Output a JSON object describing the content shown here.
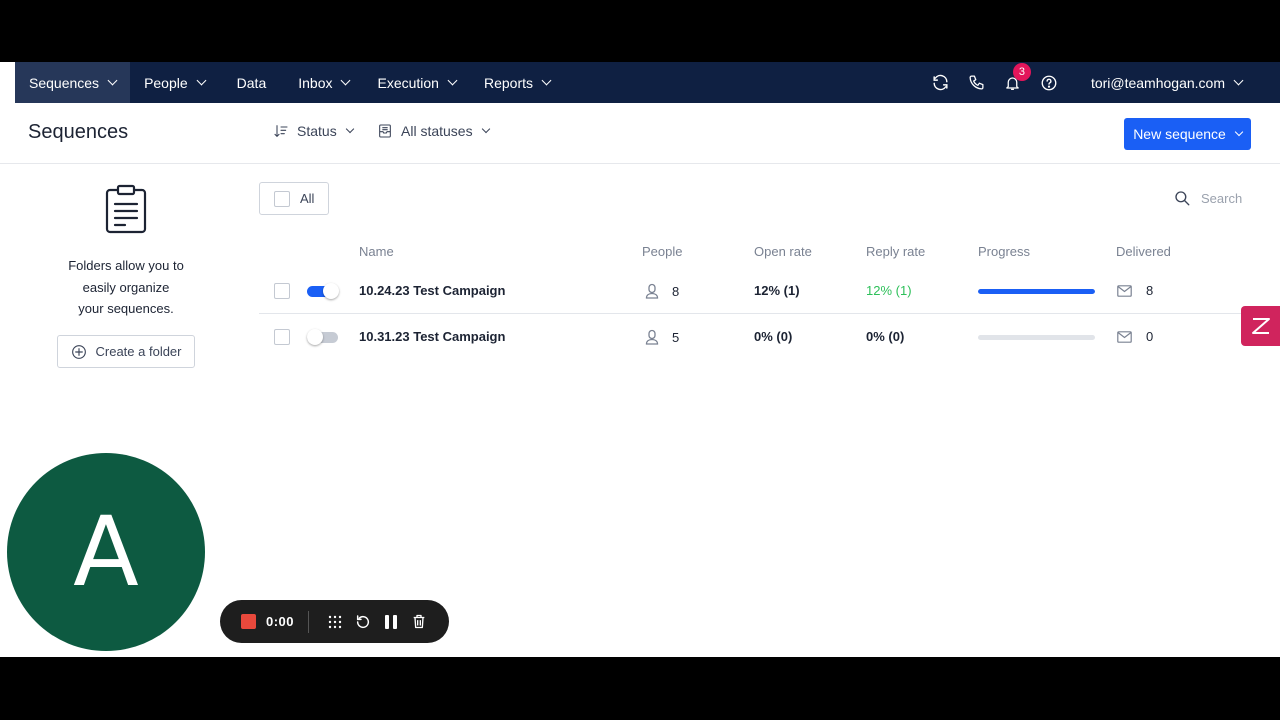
{
  "nav": {
    "items": [
      {
        "label": "Sequences",
        "dropdown": true,
        "active": true
      },
      {
        "label": "People",
        "dropdown": true
      },
      {
        "label": "Data",
        "dropdown": false
      },
      {
        "label": "Inbox",
        "dropdown": true
      },
      {
        "label": "Execution",
        "dropdown": true
      },
      {
        "label": "Reports",
        "dropdown": true
      }
    ],
    "notification_count": "3",
    "user_email": "tori@teamhogan.com"
  },
  "header": {
    "title": "Sequences",
    "sort_label": "Status",
    "status_filter_label": "All statuses",
    "new_sequence_label": "New sequence"
  },
  "sidebar": {
    "message_line1": "Folders allow you to",
    "message_line2": "easily organize",
    "message_line3": "your sequences.",
    "create_folder_label": "Create a folder"
  },
  "toolbar": {
    "all_label": "All",
    "search_placeholder": "Search"
  },
  "table": {
    "columns": {
      "name": "Name",
      "people": "People",
      "open_rate": "Open rate",
      "reply_rate": "Reply rate",
      "progress": "Progress",
      "delivered": "Delivered"
    },
    "rows": [
      {
        "active": true,
        "name": "10.24.23 Test Campaign",
        "people": "8",
        "open_rate": "12% (1)",
        "reply_rate": "12% (1)",
        "reply_highlight": true,
        "progress": 1.0,
        "delivered": "8"
      },
      {
        "active": false,
        "name": "10.31.23 Test Campaign",
        "people": "5",
        "open_rate": "0% (0)",
        "reply_rate": "0% (0)",
        "reply_highlight": false,
        "progress": 0.0,
        "delivered": "0"
      }
    ]
  },
  "avatar": {
    "initial": "A"
  },
  "recorder": {
    "time": "0:00"
  },
  "colors": {
    "nav_bg": "#0f2042",
    "primary": "#1a5ff5",
    "reply_green": "#2ec05a",
    "badge": "#e3165b",
    "avatar_bg": "#0d5a41",
    "zendesk": "#d0245d"
  }
}
